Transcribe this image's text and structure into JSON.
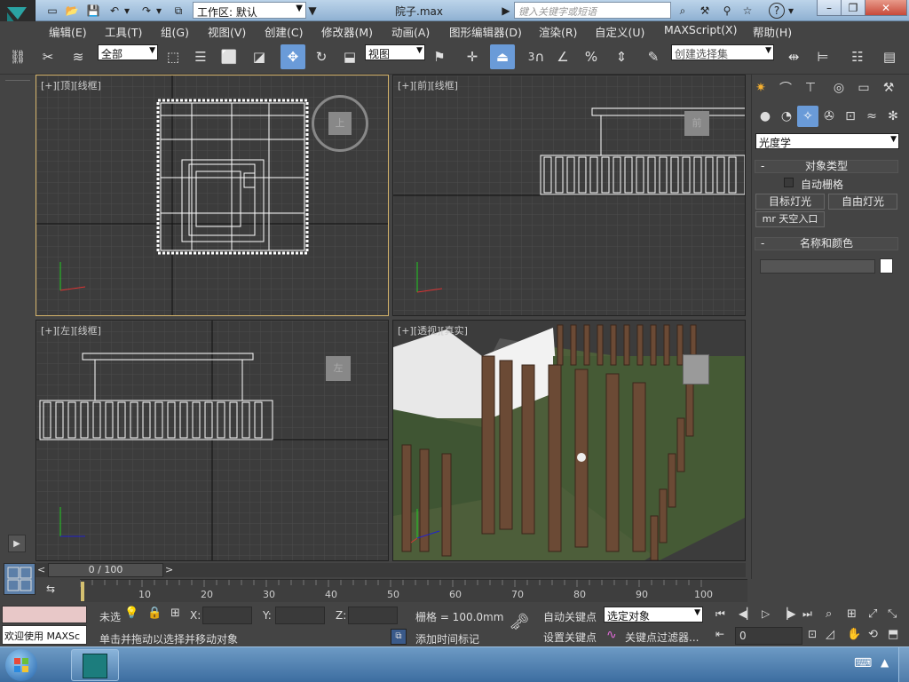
{
  "title_bar": {
    "workspace_label": "工作区: 默认",
    "file_title": "院子.max",
    "search_placeholder": "键入关键字或短语"
  },
  "menu": {
    "items": [
      "编辑(E)",
      "工具(T)",
      "组(G)",
      "视图(V)",
      "创建(C)",
      "修改器(M)",
      "动画(A)",
      "图形编辑器(D)",
      "渲染(R)",
      "自定义(U)",
      "MAXScript(X)",
      "帮助(H)"
    ]
  },
  "toolbar": {
    "selection_filter": "全部",
    "ref_coord": "视图",
    "snap_label": "3",
    "selection_set_placeholder": "创建选择集"
  },
  "viewports": {
    "top": {
      "label": "[+][顶][线框]",
      "cube_label": "上"
    },
    "front": {
      "label": "[+][前][线框]",
      "cube_label": "前"
    },
    "left": {
      "label": "[+][左][线框]",
      "cube_label": "左"
    },
    "persp": {
      "label": "[+][透视][真实]"
    }
  },
  "command_panel": {
    "category": "光度学",
    "object_type_title": "对象类型",
    "auto_grid": "自动栅格",
    "buttons": [
      "目标灯光",
      "自由灯光",
      "mr 天空入口"
    ],
    "name_color_title": "名称和颜色",
    "name_value": ""
  },
  "timeline": {
    "frame_display": "0 / 100",
    "ticks": [
      "10",
      "20",
      "30",
      "40",
      "50",
      "60",
      "70",
      "80",
      "90",
      "100"
    ]
  },
  "status_bar": {
    "welcome": "欢迎使用 MAXSc",
    "selection_state": "未选",
    "x_label": "X:",
    "y_label": "Y:",
    "z_label": "Z:",
    "grid_info": "栅格 = 100.0mm",
    "prompt": "单击并拖动以选择并移动对象",
    "add_time_tag": "添加时间标记",
    "auto_key": "自动关键点",
    "set_key": "设置关键点",
    "key_mode": "选定对象",
    "key_filters": "关键点过滤器...",
    "current_frame": "0"
  },
  "colors": {
    "accent": "#6a9bd8",
    "viewport_bg": "#3c3c3c",
    "active_border": "#d4b36a",
    "taskbar": "#3c6da0"
  }
}
